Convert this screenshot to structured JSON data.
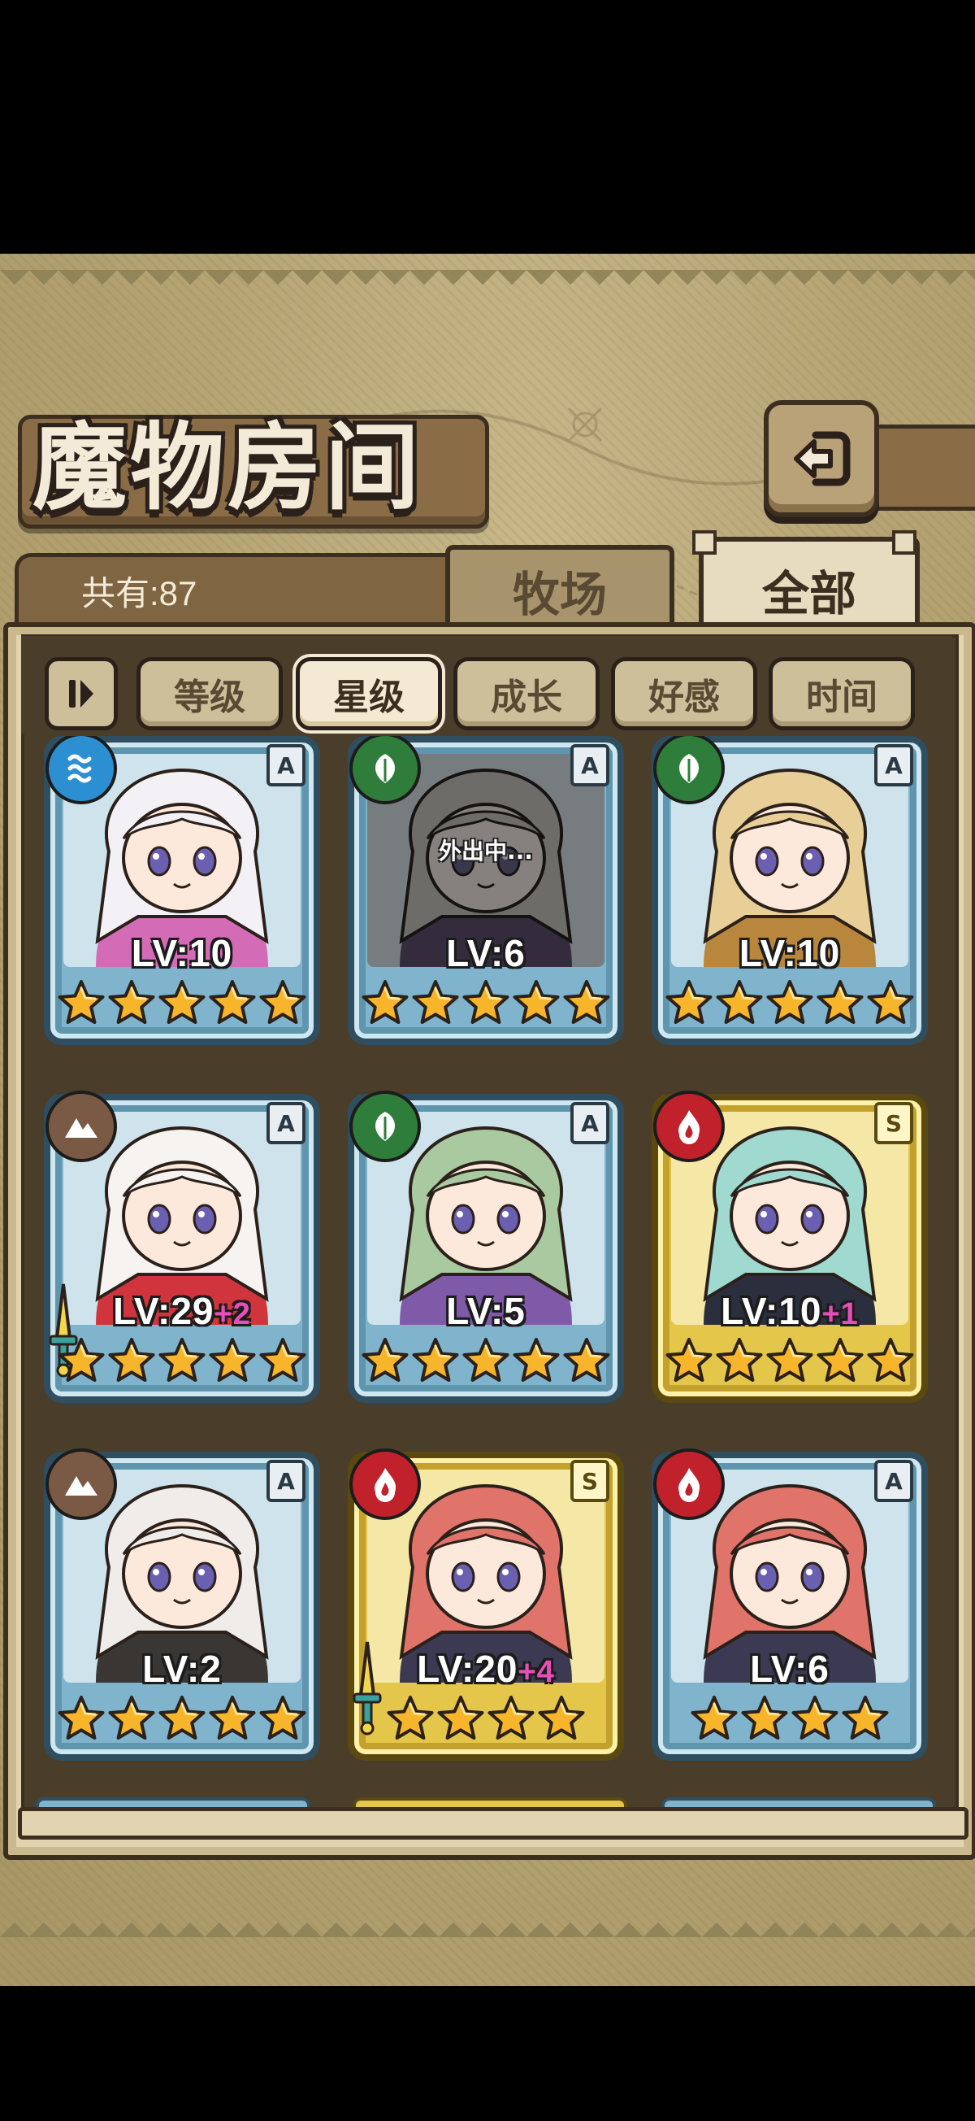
{
  "title": "魔物房间",
  "header": {
    "count_text": "共有:87"
  },
  "tabs": [
    {
      "label": "牧场",
      "active": false
    },
    {
      "label": "全部",
      "active": true
    }
  ],
  "sort_buttons": [
    {
      "label": "等级",
      "active": false
    },
    {
      "label": "星级",
      "active": true
    },
    {
      "label": "成长",
      "active": false
    },
    {
      "label": "好感",
      "active": false
    },
    {
      "label": "时间",
      "active": false
    }
  ],
  "icons": {
    "back": "back-arrow-icon",
    "sort_toggle": "sort-order-icon"
  },
  "colors": {
    "frame_a": "#7fb4cc",
    "frame_s": "#e3c64a",
    "water": "#2c8fd1",
    "leaf": "#2e7d3a",
    "earth": "#7a5a44",
    "fire": "#c0212b",
    "bonus_pink": "#e64fb7"
  },
  "monsters": [
    {
      "level": "LV:10",
      "bonus": "",
      "rank": "A",
      "element": "water",
      "stars": 5,
      "weapon": false,
      "away_text": "",
      "hair": "#f4f1f6",
      "accent": "#d36bb7"
    },
    {
      "level": "LV:6",
      "bonus": "",
      "rank": "A",
      "element": "leaf",
      "stars": 5,
      "weapon": false,
      "away_text": "外出中...",
      "hair": "#c8c4b6",
      "accent": "#6b4a8a"
    },
    {
      "level": "LV:10",
      "bonus": "",
      "rank": "A",
      "element": "leaf",
      "stars": 5,
      "weapon": false,
      "away_text": "",
      "hair": "#e8cf98",
      "accent": "#b8863c"
    },
    {
      "level": "LV:29",
      "bonus": "+2",
      "rank": "A",
      "element": "earth",
      "stars": 5,
      "weapon": true,
      "away_text": "",
      "hair": "#f6f3f0",
      "accent": "#d0353d"
    },
    {
      "level": "LV:5",
      "bonus": "",
      "rank": "A",
      "element": "leaf",
      "stars": 5,
      "weapon": false,
      "away_text": "",
      "hair": "#a9c9a0",
      "accent": "#7e5aa8"
    },
    {
      "level": "LV:10",
      "bonus": "+1",
      "rank": "S",
      "element": "fire",
      "stars": 5,
      "weapon": false,
      "away_text": "",
      "hair": "#9fd9cf",
      "accent": "#2b2f3d"
    },
    {
      "level": "LV:2",
      "bonus": "",
      "rank": "A",
      "element": "earth",
      "stars": 5,
      "weapon": false,
      "away_text": "",
      "hair": "#f0ecea",
      "accent": "#3a3634"
    },
    {
      "level": "LV:20",
      "bonus": "+4",
      "rank": "S",
      "element": "fire",
      "stars": 4,
      "weapon": true,
      "away_text": "",
      "hair": "#e0736a",
      "accent": "#3b3a52"
    },
    {
      "level": "LV:6",
      "bonus": "",
      "rank": "A",
      "element": "fire",
      "stars": 4,
      "weapon": false,
      "away_text": "",
      "hair": "#e0736a",
      "accent": "#3b3a52"
    }
  ]
}
